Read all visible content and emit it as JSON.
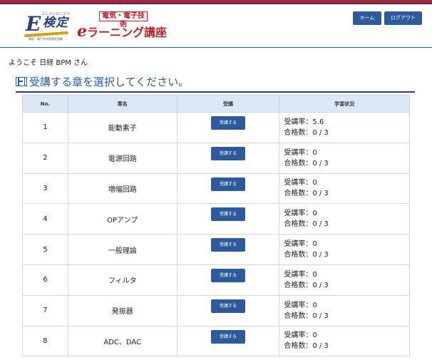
{
  "header": {
    "logo_top_caption": "エレクトロニクス",
    "logo_letter": "E",
    "logo_main": "検定",
    "logo_bottom_caption": "電気・電子系技術検定試験",
    "tag": "電気・電子技術",
    "elearn_e": "e",
    "elearn_rest": "ラーニング講座",
    "home_label": "ホーム",
    "logout_label": "ログアウト"
  },
  "welcome": "ようこそ 日経 BPM さん",
  "page_title": "受講する章を選択してください。",
  "table": {
    "headers": [
      "No.",
      "章名",
      "受講",
      "学習状況"
    ],
    "attend_label": "受講する",
    "rows": [
      {
        "no": "1",
        "name": "能動素子",
        "rate": "受講率：5.6",
        "passed": "合格数：0 / 3"
      },
      {
        "no": "2",
        "name": "電源回路",
        "rate": "受講率：0",
        "passed": "合格数：0 / 3"
      },
      {
        "no": "3",
        "name": "増幅回路",
        "rate": "受講率：0",
        "passed": "合格数：0 / 3"
      },
      {
        "no": "4",
        "name": "OPアンプ",
        "rate": "受講率：0",
        "passed": "合格数：0 / 3"
      },
      {
        "no": "5",
        "name": "一般理論",
        "rate": "受講率：0",
        "passed": "合格数：0 / 3"
      },
      {
        "no": "6",
        "name": "フィルタ",
        "rate": "受講率：0",
        "passed": "合格数：0 / 3"
      },
      {
        "no": "7",
        "name": "発振器",
        "rate": "受講率：0",
        "passed": "合格数：0 / 3"
      },
      {
        "no": "8",
        "name": "ADC、DAC",
        "rate": "受講率：0",
        "passed": "合格数：0 / 3"
      }
    ]
  },
  "colors": {
    "brand_red": "#b4232e",
    "brand_navy": "#2d3d7b",
    "button_blue": "#2c5a9a",
    "header_cell_bg": "#dbe9f7"
  },
  "icons": {
    "title_icon": "film-icon"
  }
}
